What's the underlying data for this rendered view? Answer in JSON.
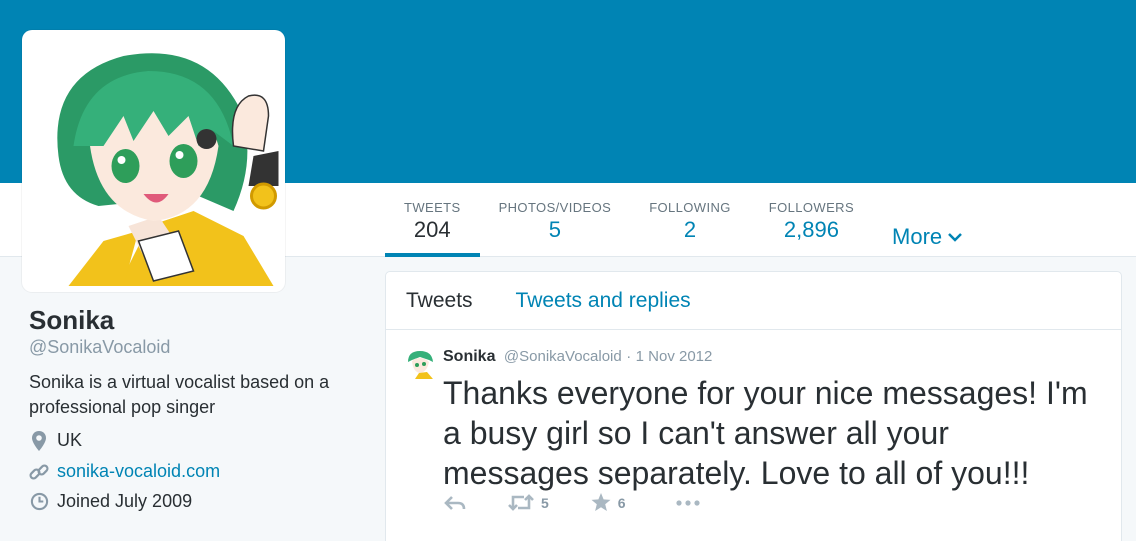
{
  "colors": {
    "accent": "#0084b4",
    "banner": "#0084b4",
    "text": "#292f33",
    "muted": "#8899a6"
  },
  "profile": {
    "name": "Sonika",
    "handle": "@SonikaVocaloid",
    "bio": "Sonika is a virtual vocalist based on a professional pop singer",
    "location": "UK",
    "website": "sonika-vocaloid.com",
    "joined": "Joined July 2009"
  },
  "stats": [
    {
      "label": "TWEETS",
      "value": "204"
    },
    {
      "label": "PHOTOS/VIDEOS",
      "value": "5"
    },
    {
      "label": "FOLLOWING",
      "value": "2"
    },
    {
      "label": "FOLLOWERS",
      "value": "2,896"
    }
  ],
  "more_label": "More",
  "timeline": {
    "tabs": [
      "Tweets",
      "Tweets and replies"
    ],
    "tweets": [
      {
        "name": "Sonika",
        "handle": "@SonikaVocaloid",
        "separator": "·",
        "time": "1 Nov 2012",
        "text": "Thanks everyone for your nice messages! I'm a busy girl so I can't answer all your messages separately. Love to all of you!!!",
        "retweets": "5",
        "favorites": "6"
      }
    ]
  },
  "icons": [
    "location-pin-icon",
    "link-icon",
    "clock-icon",
    "chevron-down-icon",
    "reply-icon",
    "retweet-icon",
    "favorite-star-icon",
    "more-dots-icon"
  ]
}
